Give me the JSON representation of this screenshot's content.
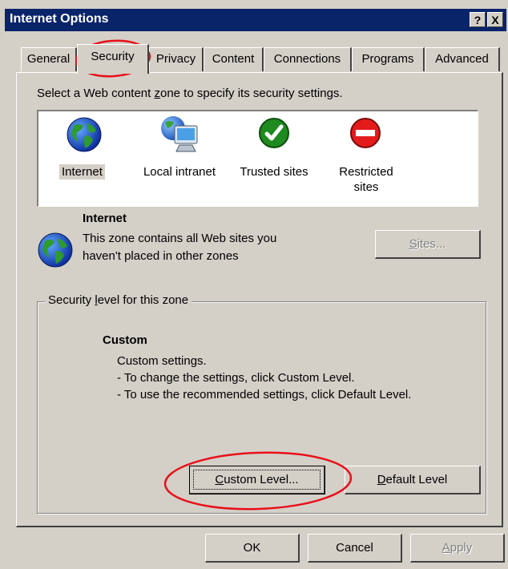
{
  "window": {
    "title": "Internet Options",
    "help_label": "?",
    "close_label": "X"
  },
  "tabs": [
    {
      "label": "General",
      "active": false
    },
    {
      "label": "Security",
      "active": true
    },
    {
      "label": "Privacy",
      "active": false
    },
    {
      "label": "Content",
      "active": false
    },
    {
      "label": "Connections",
      "active": false
    },
    {
      "label": "Programs",
      "active": false
    },
    {
      "label": "Advanced",
      "active": false
    }
  ],
  "security": {
    "instruction_pre": "Select a Web content ",
    "instruction_u": "z",
    "instruction_post": "one to specify its security settings.",
    "zones": [
      {
        "name": "Internet",
        "icon": "globe-icon",
        "selected": true
      },
      {
        "name": "Local intranet",
        "icon": "intranet-computer-icon",
        "selected": false
      },
      {
        "name": "Trusted sites",
        "icon": "checkmark-icon",
        "selected": false
      },
      {
        "name": "Restricted sites",
        "line1": "Restricted",
        "line2": "sites",
        "icon": "no-entry-icon",
        "selected": false
      }
    ],
    "selected_zone": {
      "title": "Internet",
      "desc_line1": "This zone contains all Web sites you",
      "desc_line2": "haven't placed in other zones"
    },
    "sites_button": {
      "pre": "",
      "u": "S",
      "post": "ites...",
      "enabled": false
    },
    "level_group": {
      "title_pre": "Security ",
      "title_u": "l",
      "title_post": "evel for this zone",
      "level_name": "Custom",
      "line1": "Custom settings.",
      "line2": "- To change the settings, click Custom Level.",
      "line3": "- To use the recommended settings, click Default Level."
    },
    "custom_level_button": {
      "u": "C",
      "post": "ustom Level..."
    },
    "default_level_button": {
      "u": "D",
      "post": "efault Level"
    }
  },
  "footer": {
    "ok_label": "OK",
    "cancel_label": "Cancel",
    "apply_u": "A",
    "apply_post": "pply",
    "apply_enabled": false
  },
  "colors": {
    "titlebar": "#0a246a",
    "face": "#d4d0c8",
    "annotation": "#e8101a"
  }
}
